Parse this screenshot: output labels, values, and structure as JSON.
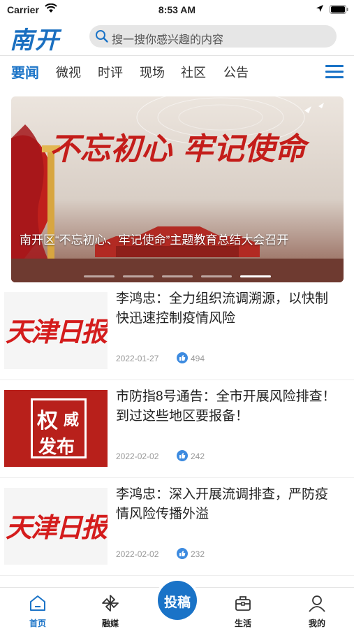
{
  "status_bar": {
    "carrier": "Carrier",
    "time": "8:53 AM"
  },
  "header": {
    "logo_text": "南开",
    "search": {
      "placeholder": "搜一搜你感兴趣的内容"
    }
  },
  "tabs": [
    {
      "label": "要闻",
      "active": true
    },
    {
      "label": "微视",
      "active": false
    },
    {
      "label": "时评",
      "active": false
    },
    {
      "label": "现场",
      "active": false
    },
    {
      "label": "社区",
      "active": false
    },
    {
      "label": "公告",
      "active": false
    }
  ],
  "banner": {
    "slogan": "不忘初心 牢记使命",
    "caption": "南开区“不忘初心、牢记使命”主题教育总结大会召开",
    "slide_count": 5,
    "active_slide": 4
  },
  "news": [
    {
      "thumb_text": "天津日报",
      "title": "李鸿忠：全力组织流调溯源，以快制快迅速控制疫情风险",
      "date": "2022-01-27",
      "likes": "494"
    },
    {
      "thumb_text_1": "权",
      "thumb_text_1b": "威",
      "thumb_text_2": "发布",
      "title": "市防指8号通告：全市开展风险排查！到过这些地区要报备！",
      "date": "2022-02-02",
      "likes": "242"
    },
    {
      "thumb_text": "天津日报",
      "title": "李鸿忠：深入开展流调排查，严防疫情风险传播外溢",
      "date": "2022-02-02",
      "likes": "232"
    }
  ],
  "tabbar": {
    "items": [
      {
        "label": "首页",
        "icon": "home-icon",
        "active": true
      },
      {
        "label": "融媒",
        "icon": "pinwheel-icon",
        "active": false
      },
      {
        "label": "生活",
        "icon": "briefcase-icon",
        "active": false
      },
      {
        "label": "我的",
        "icon": "person-icon",
        "active": false
      }
    ],
    "submit_label": "投稿"
  },
  "colors": {
    "accent": "#1a73c7",
    "banner_red": "#b8201b",
    "paper_red": "#d41c1c"
  }
}
